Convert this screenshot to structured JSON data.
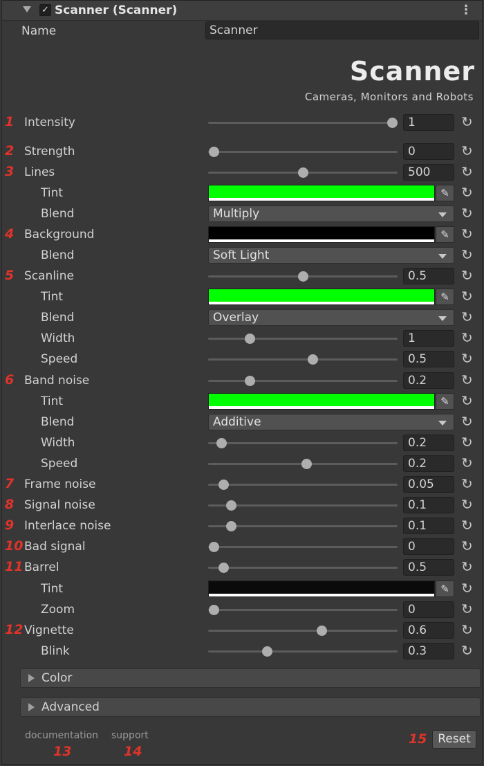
{
  "header": {
    "title": "Scanner (Scanner)",
    "enabled": true
  },
  "name_field": {
    "label": "Name",
    "value": "Scanner"
  },
  "logo": {
    "title": "Scanner",
    "tagline": "Cameras, Monitors and Robots"
  },
  "accent_color": "#e0332a",
  "rows": {
    "intensity": {
      "num": "1",
      "label": "Intensity",
      "value": "1",
      "slider": 0.97
    },
    "strength": {
      "num": "2",
      "label": "Strength",
      "value": "0",
      "slider": 0.03
    },
    "lines": {
      "num": "3",
      "label": "Lines",
      "value": "500",
      "slider": 0.5
    },
    "lines_tint": {
      "label": "Tint",
      "color": "#00ff00"
    },
    "lines_blend": {
      "label": "Blend",
      "value": "Multiply"
    },
    "background": {
      "num": "4",
      "label": "Background",
      "color": "#000000"
    },
    "background_blend": {
      "label": "Blend",
      "value": "Soft Light"
    },
    "scanline": {
      "num": "5",
      "label": "Scanline",
      "value": "0.5",
      "slider": 0.5
    },
    "scanline_tint": {
      "label": "Tint",
      "color": "#00ff00"
    },
    "scanline_blend": {
      "label": "Blend",
      "value": "Overlay"
    },
    "scanline_width": {
      "label": "Width",
      "value": "1",
      "slider": 0.22
    },
    "scanline_speed": {
      "label": "Speed",
      "value": "0.5",
      "slider": 0.55
    },
    "bandnoise": {
      "num": "6",
      "label": "Band noise",
      "value": "0.2",
      "slider": 0.22
    },
    "bandnoise_tint": {
      "label": "Tint",
      "color": "#00ff00"
    },
    "bandnoise_blend": {
      "label": "Blend",
      "value": "Additive"
    },
    "bandnoise_width": {
      "label": "Width",
      "value": "0.2",
      "slider": 0.07
    },
    "bandnoise_speed": {
      "label": "Speed",
      "value": "0.2",
      "slider": 0.52
    },
    "framenoise": {
      "num": "7",
      "label": "Frame noise",
      "value": "0.05",
      "slider": 0.08
    },
    "signalnoise": {
      "num": "8",
      "label": "Signal noise",
      "value": "0.1",
      "slider": 0.12
    },
    "interlacenoise": {
      "num": "9",
      "label": "Interlace noise",
      "value": "0.1",
      "slider": 0.12
    },
    "badsignal": {
      "num": "10",
      "label": "Bad signal",
      "value": "0",
      "slider": 0.03
    },
    "barrel": {
      "num": "11",
      "label": "Barrel",
      "value": "0.5",
      "slider": 0.08
    },
    "barrel_tint": {
      "label": "Tint",
      "color": "#0a0a0a"
    },
    "barrel_zoom": {
      "label": "Zoom",
      "value": "0",
      "slider": 0.03
    },
    "vignette": {
      "num": "12",
      "label": "Vignette",
      "value": "0.6",
      "slider": 0.6
    },
    "vignette_blink": {
      "label": "Blink",
      "value": "0.3",
      "slider": 0.31
    }
  },
  "sections": {
    "color": "Color",
    "advanced": "Advanced"
  },
  "footer": {
    "documentation": "documentation",
    "documentation_num": "13",
    "support": "support",
    "support_num": "14",
    "reset_num": "15",
    "reset_label": "Reset"
  },
  "icons": {
    "reset": "refresh-icon",
    "picker": "eyedropper-icon"
  }
}
